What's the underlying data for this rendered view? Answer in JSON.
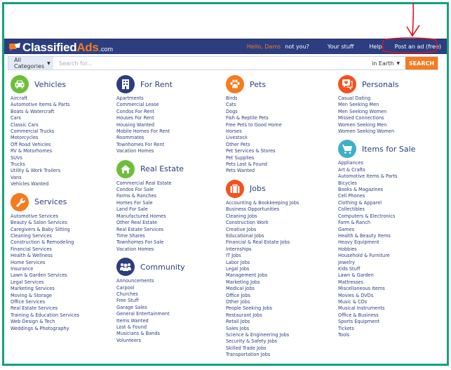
{
  "header": {
    "logo_main": "Classified",
    "logo_accent": "Ads",
    "logo_suffix": ".com",
    "greeting": "Hello, Dams",
    "not_you": "not you?",
    "your_stuff": "Your stuff",
    "help": "Help",
    "post_ad": "Post an ad (free)"
  },
  "search": {
    "category": "All Categories",
    "placeholder": "Search for...",
    "location": "in Earth",
    "button": "SEARCH"
  },
  "colors": {
    "navbar": "#2c3e7f",
    "accent_orange": "#f47b20",
    "link_blue": "#2c3e7f",
    "frame_green": "#12a37a",
    "annotation_red": "#e0141e",
    "icon_green": "#6cbf3a",
    "icon_navy": "#2c3e7f",
    "icon_orange": "#f47b20",
    "icon_red_orange": "#f4511e",
    "icon_teal": "#3fb0c9"
  },
  "categories": {
    "vehicles": {
      "title": "Vehicles",
      "icon": "car-icon",
      "items": [
        "Aircraft",
        "Automotive Items & Parts",
        "Boats & Watercraft",
        "Cars",
        "Classic Cars",
        "Commercial Trucks",
        "Motorcycles",
        "Off Road Vehicles",
        "RV & Motorhomes",
        "SUVs",
        "Trucks",
        "Utility & Work Trailers",
        "Vans",
        "Vehicles Wanted"
      ]
    },
    "services": {
      "title": "Services",
      "icon": "wrench-icon",
      "items": [
        "Automotive Services",
        "Beauty & Salon Services",
        "Caregivers & Baby Sitting",
        "Cleaning Services",
        "Construction & Remodeling",
        "Financial Services",
        "Health & Wellness",
        "Home Services",
        "Insurance",
        "Lawn & Garden Services",
        "Legal Services",
        "Marketing Services",
        "Moving & Storage",
        "Office Services",
        "Real Estate Services",
        "Training & Education Services",
        "Web Design & Tech",
        "Weddings & Photography"
      ]
    },
    "for_rent": {
      "title": "For Rent",
      "icon": "building-icon",
      "items": [
        "Apartments",
        "Commercial Lease",
        "Condos For Rent",
        "Houses For Rent",
        "Housing Wanted",
        "Mobile Homes For Rent",
        "Roommates",
        "Townhomes For Rent",
        "Vacation Homes"
      ]
    },
    "real_estate": {
      "title": "Real Estate",
      "icon": "house-icon",
      "items": [
        "Commercial Real Estate",
        "Condos For Sale",
        "Farms & Ranches",
        "Homes For Sale",
        "Land For Sale",
        "Manufactured Homes",
        "Other Real Estate",
        "Real Estate Services",
        "Time Shares",
        "Townhomes For Sale",
        "Vacation Homes"
      ]
    },
    "community": {
      "title": "Community",
      "icon": "people-icon",
      "items": [
        "Announcements",
        "Carpool",
        "Churches",
        "Free Stuff",
        "Garage Sales",
        "General Entertainment",
        "Items Wanted",
        "Lost & Found",
        "Musicians & Bands",
        "Volunteers"
      ]
    },
    "pets": {
      "title": "Pets",
      "icon": "paw-icon",
      "items": [
        "Birds",
        "Cats",
        "Dogs",
        "Fish & Reptile Pets",
        "Free Pets to Good Home",
        "Horses",
        "Livestock",
        "Other Pets",
        "Pet Services & Stores",
        "Pet Supplies",
        "Pets Lost & Found",
        "Pets Wanted"
      ]
    },
    "jobs": {
      "title": "Jobs",
      "icon": "briefcase-icon",
      "items": [
        "Accounting & Bookkeeping Jobs",
        "Business Opportunities",
        "Cleaning Jobs",
        "Construction Work",
        "Creative Jobs",
        "Educational Jobs",
        "Financial & Real Estate Jobs",
        "Internships",
        "IT Jobs",
        "Labor Jobs",
        "Legal Jobs",
        "Management Jobs",
        "Marketing Jobs",
        "Medical Jobs",
        "Office Jobs",
        "Other Jobs",
        "People Seeking Jobs",
        "Restaurant Jobs",
        "Retail Jobs",
        "Sales Jobs",
        "Science & Engineering Jobs",
        "Security & Safety Jobs",
        "Skilled Trade Jobs",
        "Transportation Jobs"
      ]
    },
    "personals": {
      "title": "Personals",
      "icon": "chat-heart-icon",
      "items": [
        "Casual Dating",
        "Men Seeking Men",
        "Men Seeking Women",
        "Missed Connections",
        "Women Seeking Men",
        "Women Seeking Women"
      ]
    },
    "items_for_sale": {
      "title": "Items for Sale",
      "icon": "cart-icon",
      "items": [
        "Appliances",
        "Art & Crafts",
        "Automotive Items & Parts",
        "Bicycles",
        "Books & Magazines",
        "Cell Phones",
        "Clothing & Apparel",
        "Collectibles",
        "Computers & Electronics",
        "Farm & Ranch",
        "Games",
        "Health & Beauty Items",
        "Heavy Equipment",
        "Hobbies",
        "Household & Furniture",
        "Jewelry",
        "Kids Stuff",
        "Lawn & Garden",
        "Mattresses",
        "Miscellaneous Items",
        "Movies & DVDs",
        "Music & CDs",
        "Musical Instruments",
        "Office & Business",
        "Sports Equipment",
        "Tickets",
        "Tools"
      ]
    }
  }
}
